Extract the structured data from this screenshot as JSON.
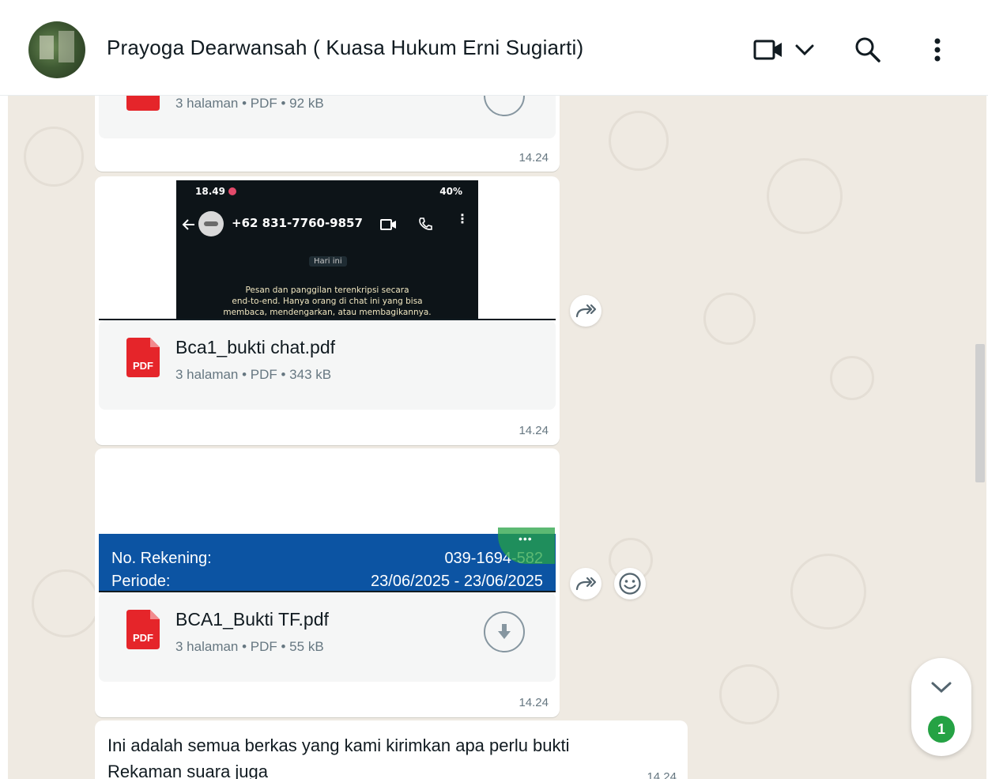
{
  "header": {
    "contact_name": "Prayoga Dearwansah ( Kuasa Hukum Erni Sugiarti)"
  },
  "messages": [
    {
      "type": "document",
      "file_meta": "3 halaman • PDF • 92 kB",
      "time": "14.24"
    },
    {
      "type": "document",
      "preview": {
        "status_time": "18.49",
        "status_battery": "40%",
        "phone_number": "+62 831-7760-9857",
        "date_chip": "Hari ini",
        "encryption_line1": "Pesan dan panggilan terenkripsi secara",
        "encryption_line2": "end-to-end. Hanya orang di chat ini yang bisa",
        "encryption_line3": "membaca, mendengarkan, atau membagikannya."
      },
      "file_icon_label": "PDF",
      "file_name": "Bca1_bukti chat.pdf",
      "file_meta": "3 halaman • PDF • 343 kB",
      "time": "14.24"
    },
    {
      "type": "document",
      "preview": {
        "rekening_label": "No. Rekening:",
        "rekening_value": "039-1694-582",
        "periode_label": "Periode:",
        "periode_value": "23/06/2025 - 23/06/2025"
      },
      "file_icon_label": "PDF",
      "file_name": "BCA1_Bukti TF.pdf",
      "file_meta": "3 halaman • PDF • 55 kB",
      "time": "14.24"
    },
    {
      "type": "text",
      "text_line1": "Ini adalah semua berkas yang kami kirimkan apa perlu bukti",
      "text_line2": "Rekaman suara juga",
      "time": "14.24"
    }
  ],
  "scroll_down": {
    "unread_count": "1"
  },
  "colors": {
    "chat_background": "#efeae2",
    "pdf_red": "#e5252a",
    "bank_blue": "#0c54a3",
    "badge_green": "#25a244"
  },
  "icons": [
    "video-call-icon",
    "chevron-down-icon",
    "search-icon",
    "menu-icon",
    "pdf-icon",
    "download-icon",
    "forward-icon",
    "emoji-icon"
  ]
}
